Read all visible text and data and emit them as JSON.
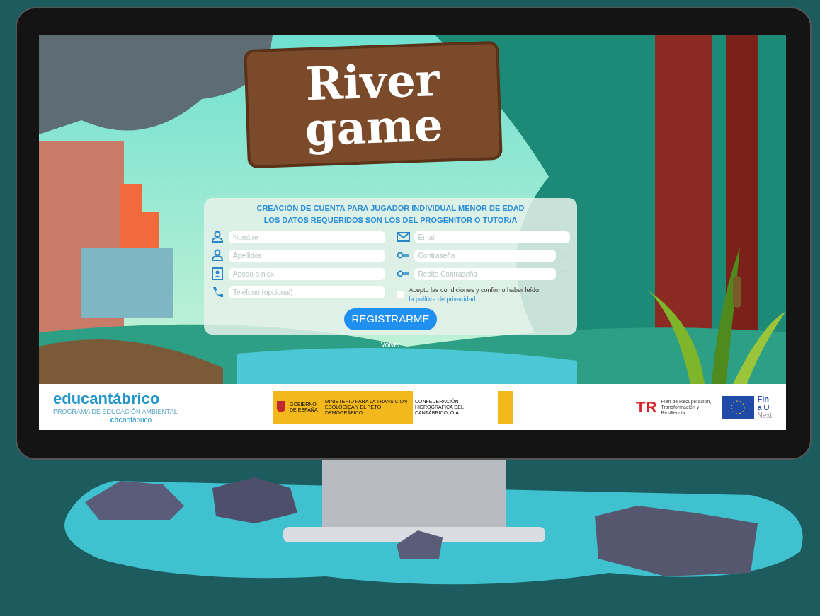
{
  "logo": {
    "line_1": "River",
    "line_2": "game"
  },
  "form": {
    "title_lines": [
      "CREACIÓN DE CUENTA PARA JUGADOR INDIVIDUAL MENOR DE EDAD",
      "LOS DATOS REQUERIDOS SON LOS DEL PROGENITOR O TUTOR/A"
    ],
    "left_fields": [
      {
        "kind": "person",
        "placeholder": "Nombre"
      },
      {
        "kind": "person",
        "placeholder": "Apellidos"
      },
      {
        "kind": "badge",
        "placeholder": "Apodo o nick"
      },
      {
        "kind": "phone",
        "placeholder": "Teléfono (opcional)"
      }
    ],
    "right_fields": [
      {
        "kind": "mail",
        "placeholder": "Email"
      },
      {
        "kind": "password",
        "placeholder": "Contraseña"
      },
      {
        "kind": "password",
        "placeholder": "Repite Contraseña"
      }
    ],
    "terms": {
      "checked": false,
      "text": "Acepto las condiciones y confirmo haber leído",
      "link": "la política de privacidad"
    },
    "submit": "REGISTRARME"
  },
  "back_link": "Volver",
  "footer": {
    "brand": "educantábrico",
    "brand_subtitle": "PROGRAMA DE EDUCACIÓN AMBIENTAL",
    "brand_sub2_bold": "chc",
    "brand_sub2": "antábrico",
    "gov_logo": {
      "left": "GOBIERNO DE ESPAÑA",
      "middle": "MINISTERIO PARA LA TRANSICIÓN ECOLÓGICA Y EL RETO DEMOGRÁFICO",
      "right": "CONFEDERACIÓN HIDROGRÁFICA DEL CANTÁBRICO, O.A."
    },
    "recovery_mark": "TR",
    "recovery_logo": "Plan de Recuperación, Transformación y Resiliencia",
    "eu_fragments": [
      "Fin",
      "a U",
      "Next"
    ]
  }
}
